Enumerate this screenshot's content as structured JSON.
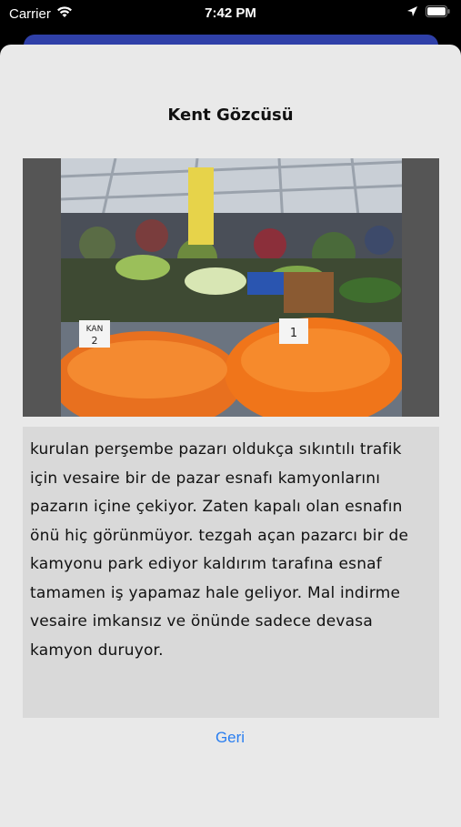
{
  "status_bar": {
    "carrier": "Carrier",
    "time": "7:42 PM",
    "icons": [
      "wifi-icon",
      "location-arrow-icon",
      "battery-icon"
    ]
  },
  "modal": {
    "title": "Kent Gözcüsü",
    "photo": {
      "signs": [
        "KAN",
        "2",
        "1"
      ]
    },
    "description": "kurulan perşembe pazarı oldukça sıkıntılı trafik için vesaire bir de pazar esnafı kamyonlarını pazarın içine çekiyor. Zaten kapalı olan esnafın önü hiç görünmüyor. tezgah açan pazarcı bir de kamyonu park ediyor kaldırım tarafına esnaf tamamen iş yapamaz hale geliyor. Mal indirme vesaire imkansız ve önünde sadece devasa kamyon duruyor.",
    "back_label": "Geri"
  },
  "colors": {
    "accent": "#2a7ef0",
    "sheet_background": "#e9e9e9",
    "text_box_background": "#d9d9d9",
    "behind_sheet": "#2f40a8"
  }
}
